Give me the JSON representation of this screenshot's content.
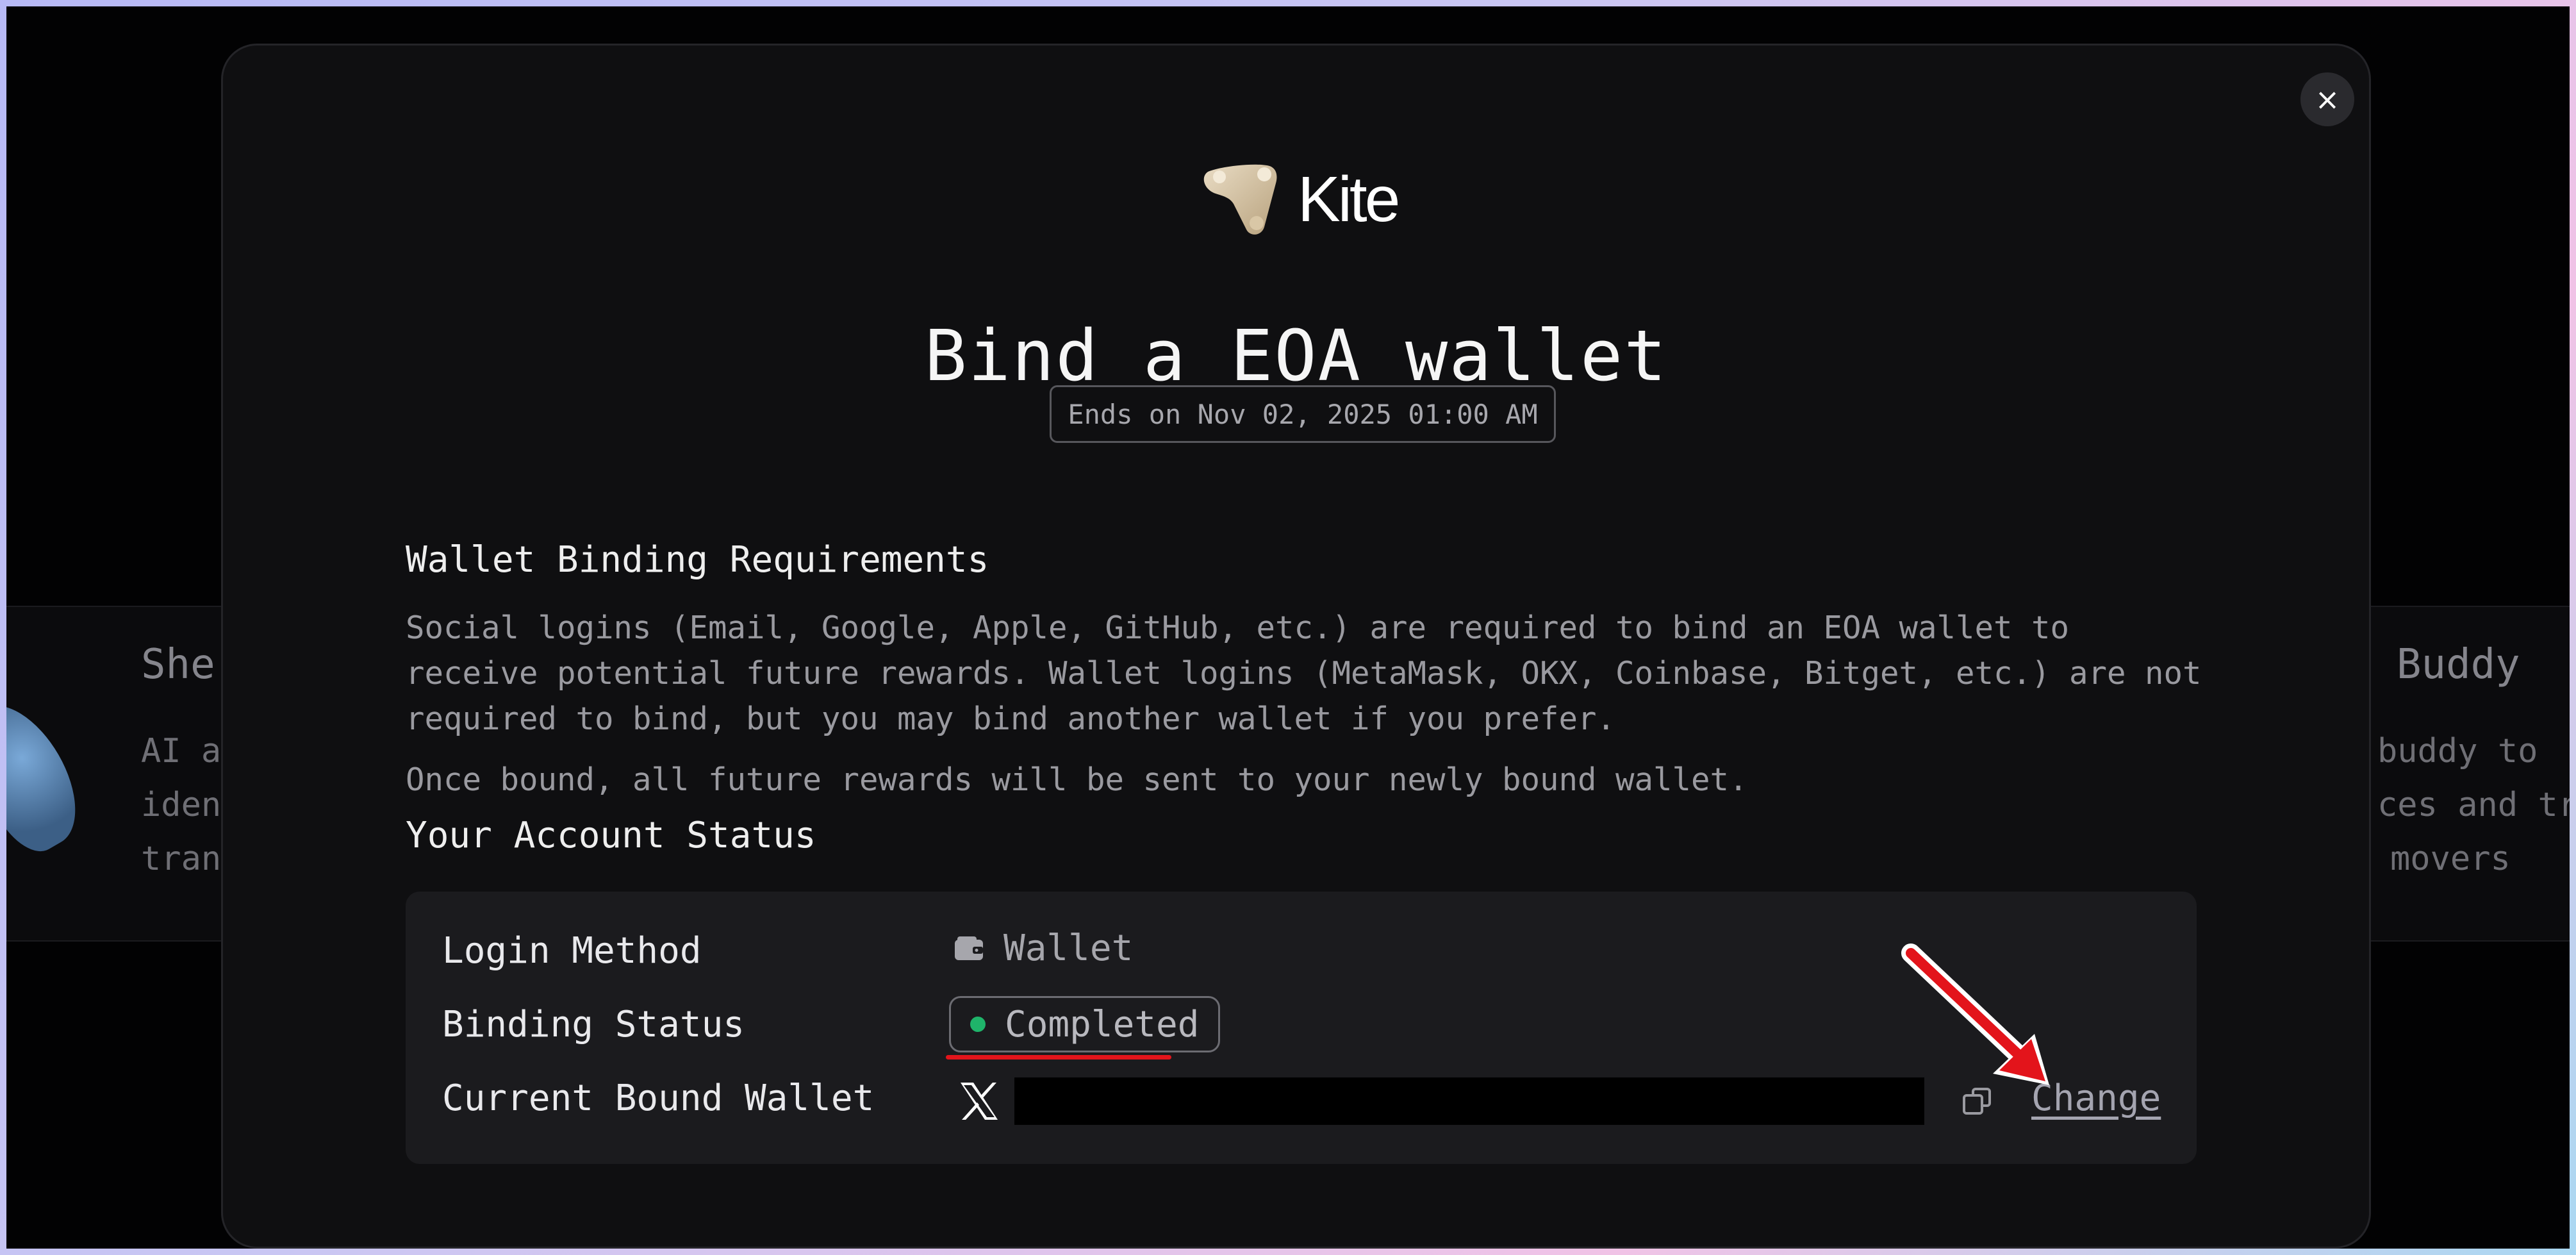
{
  "background": {
    "left_card": {
      "title": "She",
      "desc_lines": [
        "AI a",
        "iden",
        "tran"
      ]
    },
    "right_card": {
      "title": "Buddy",
      "desc_lines": [
        "buddy to",
        "ces and tr",
        "movers"
      ]
    }
  },
  "modal": {
    "close_label": "×",
    "logo_text": "Kite",
    "title": "Bind a EOA wallet",
    "ends_on": "Ends on Nov 02, 2025 01:00 AM",
    "requirements": {
      "heading": "Wallet Binding Requirements",
      "paragraph1": "Social logins (Email, Google, Apple, GitHub, etc.) are required to bind an EOA wallet to receive potential future rewards. Wallet logins (MetaMask, OKX, Coinbase, Bitget, etc.) are not required to bind, but you may bind another wallet if you prefer.",
      "paragraph2": "Once bound, all future rewards will be sent to your newly bound wallet."
    },
    "status": {
      "heading": "Your Account Status",
      "login_method_label": "Login Method",
      "login_method_value": "Wallet",
      "binding_status_label": "Binding Status",
      "binding_status_value": "Completed",
      "bound_wallet_label": "Current Bound Wallet",
      "change_label": "Change"
    }
  },
  "colors": {
    "status_dot": "#1fb46a",
    "annotation_red": "#e3141b"
  }
}
